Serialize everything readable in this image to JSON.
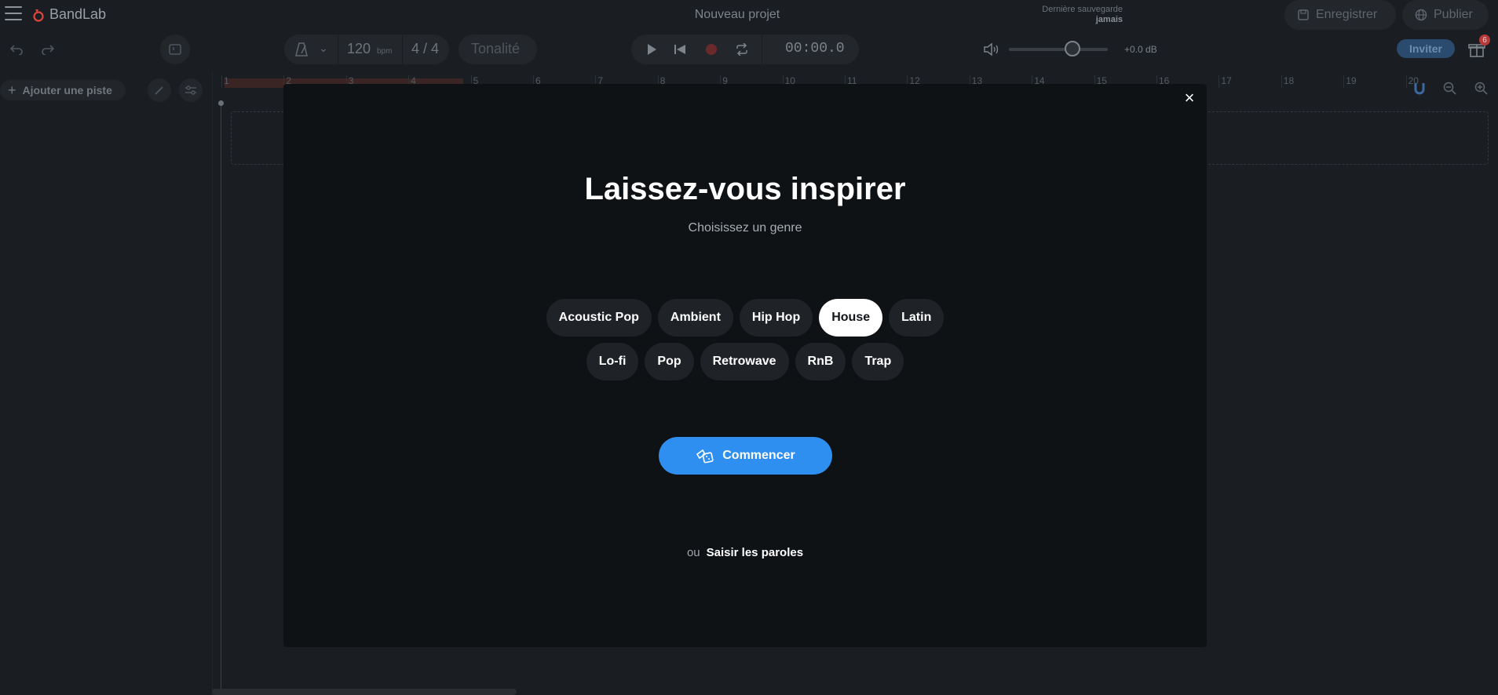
{
  "app": {
    "name": "BandLab"
  },
  "header": {
    "project_title": "Nouveau projet",
    "last_saved_label": "Dernière sauvegarde",
    "last_saved_value": "jamais",
    "save_label": "Enregistrer",
    "publish_label": "Publier"
  },
  "toolbar": {
    "bpm_value": "120",
    "bpm_unit": "bpm",
    "time_signature": "4 / 4",
    "key_label": "Tonalité",
    "time_readout": "00:00.0",
    "volume_db": "+0.0 dB",
    "volume_level_fraction": 0.6,
    "invite_label": "Inviter",
    "notification_count": "6"
  },
  "tracks": {
    "add_track_label": "Ajouter une piste"
  },
  "ruler": {
    "measures": [
      "1",
      "2",
      "3",
      "4",
      "5",
      "6",
      "7",
      "8",
      "9",
      "10",
      "11",
      "12",
      "13",
      "14",
      "15",
      "16",
      "17",
      "18",
      "19",
      "20"
    ]
  },
  "modal": {
    "title": "Laissez-vous inspirer",
    "subtitle": "Choisissez un genre",
    "genres_row1": [
      "Acoustic Pop",
      "Ambient",
      "Hip Hop",
      "House",
      "Latin"
    ],
    "genres_row2": [
      "Lo-fi",
      "Pop",
      "Retrowave",
      "RnB",
      "Trap"
    ],
    "selected_genre": "House",
    "start_label": "Commencer",
    "or_label": "ou",
    "lyrics_label": "Saisir les paroles",
    "close_symbol": "×"
  },
  "colors": {
    "accent": "#2f8ff0",
    "modal_bg": "#0f1215",
    "app_bg": "#1a1d21",
    "logo_red": "#e0453b"
  }
}
